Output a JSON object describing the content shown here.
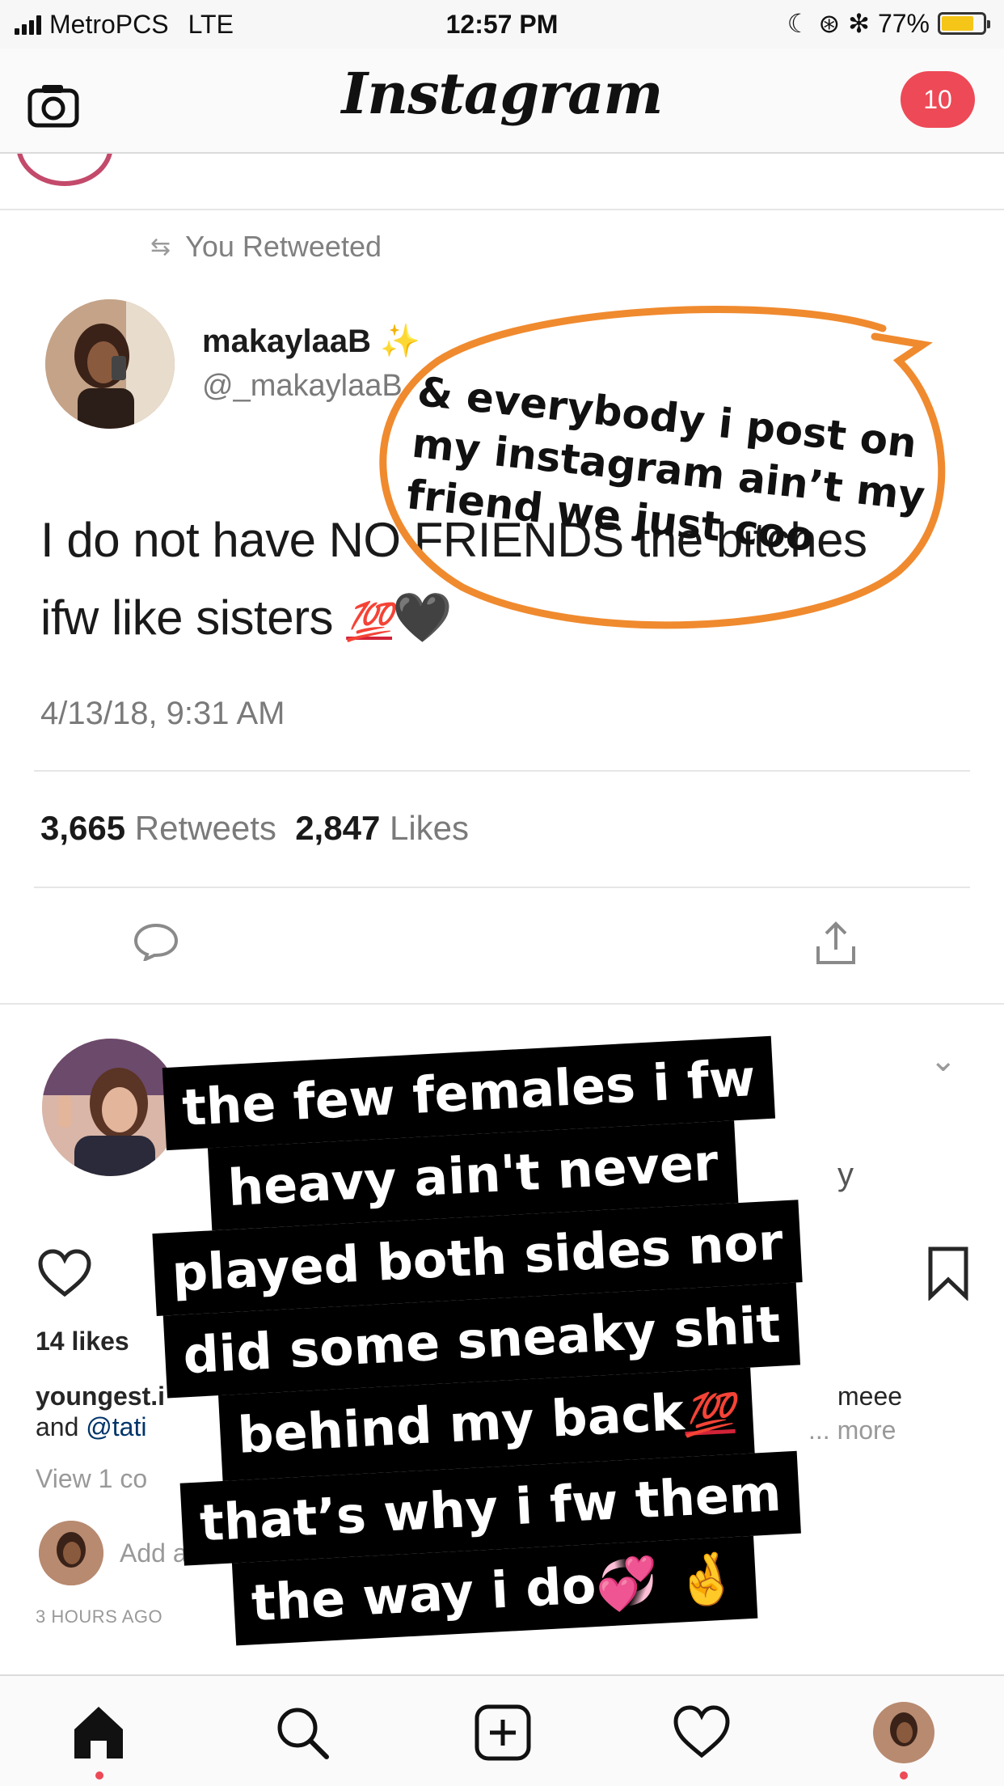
{
  "status_bar": {
    "carrier": "MetroPCS",
    "network": "LTE",
    "time": "12:57 PM",
    "battery": "77%",
    "battery_level": 0.77
  },
  "header": {
    "logo": "Instagram",
    "notification_count": "10"
  },
  "tweet": {
    "retweet_label": "You Retweeted",
    "display_name": "makaylaaB",
    "handle": "@_makaylaaB",
    "text_line1": "I do not have NO FRIENDS the bitches",
    "text_line2": "ifw like sisters",
    "emoji_100": "💯",
    "emoji_heart": "🖤",
    "date": "4/13/18, 9:31 AM",
    "retweets_count": "3,665",
    "retweets_label": "Retweets",
    "likes_count": "2,847",
    "likes_label": "Likes"
  },
  "annotation": {
    "circle_text": "& everybody i post on my instagram ain’t my friend we just coo",
    "accent_color": "#f08a2e"
  },
  "overlay_caption": {
    "lines": [
      "the few females i fw",
      "heavy ain't never",
      "played both sides nor",
      "did some sneaky shit",
      "behind my back",
      "that’s why i fw them",
      "the way i do"
    ],
    "emoji_100": "💯",
    "emoji_hearts": "💞",
    "emoji_fingers": "🤞"
  },
  "post": {
    "partial_right": "y",
    "likes": "14 likes",
    "caption_user": "youngest.i",
    "caption_and": "and",
    "caption_mention": "@tati",
    "caption_end": "meee",
    "caption_more": "... more",
    "view_comments": "View 1 co",
    "add_comment": "Add a co",
    "time_ago": "3 HOURS AGO"
  },
  "tabs": [
    "home",
    "search",
    "new-post",
    "activity",
    "profile"
  ],
  "colors": {
    "brand_red": "#ed4956",
    "orange_ring": "#f08a2e",
    "hundred_red": "#d12338"
  }
}
